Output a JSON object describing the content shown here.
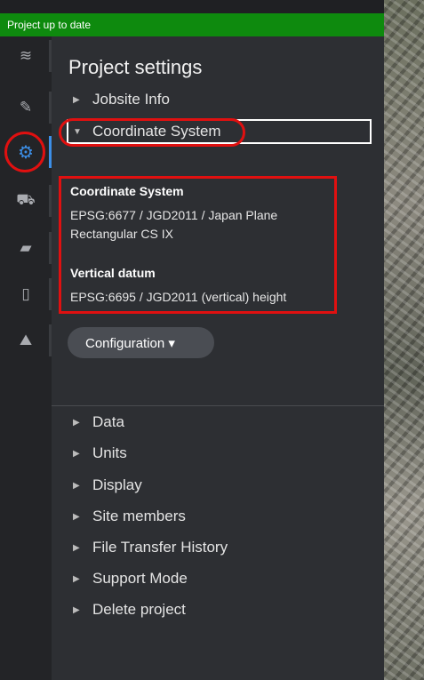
{
  "status": {
    "text": "Project up to date",
    "color": "#0e8a0e"
  },
  "sidebar_icons": [
    {
      "name": "layers-icon",
      "glyph": "≋"
    },
    {
      "name": "tools-icon",
      "glyph": "✎"
    },
    {
      "name": "gear-icon",
      "glyph": "⚙"
    },
    {
      "name": "vehicle-icon",
      "glyph": "⛟"
    },
    {
      "name": "folder-icon",
      "glyph": "▰"
    },
    {
      "name": "device-icon",
      "glyph": "▯"
    },
    {
      "name": "map-icon",
      "glyph": "⛰"
    }
  ],
  "panel": {
    "title": "Project settings",
    "jobsite_info": "Jobsite Info",
    "coordinate_system_header": "Coordinate System",
    "info": {
      "cs_label": "Coordinate System",
      "cs_value": "EPSG:6677 / JGD2011 / Japan Plane Rectangular CS IX",
      "vd_label": "Vertical datum",
      "vd_value": "EPSG:6695 / JGD2011 (vertical) height"
    },
    "configuration_button": "Configuration ▾",
    "sections": [
      "Data",
      "Units",
      "Display",
      "Site members",
      "File Transfer History",
      "Support Mode",
      "Delete project"
    ]
  },
  "accent_color": "#3c8fe8",
  "highlight_color": "#e01010"
}
